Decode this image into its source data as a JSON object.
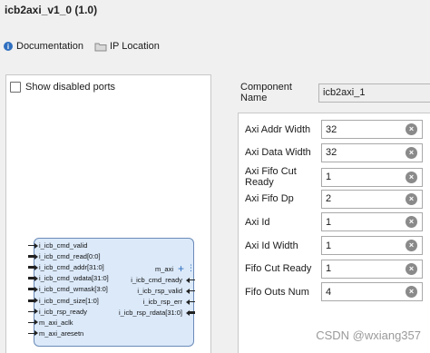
{
  "title": "icb2axi_v1_0 (1.0)",
  "toolbar": {
    "documentation_label": "Documentation",
    "documentation_icon": "book-icon",
    "ip_location_label": "IP Location",
    "ip_location_icon": "folder-icon"
  },
  "show_disabled_ports": {
    "label": "Show disabled ports",
    "checked": false
  },
  "symbol": {
    "left_ports": [
      "i_icb_cmd_valid",
      "i_icb_cmd_read[0:0]",
      "i_icb_cmd_addr[31:0]",
      "i_icb_cmd_wdata[31:0]",
      "i_icb_cmd_wmask[3:0]",
      "i_icb_cmd_size[1:0]",
      "i_icb_rsp_ready",
      "m_axi_aclk",
      "m_axi_aresetn"
    ],
    "right_ports": [
      "m_axi",
      "i_icb_cmd_ready",
      "i_icb_rsp_valid",
      "i_icb_rsp_err",
      "i_icb_rsp_rdata[31:0]"
    ],
    "colors": {
      "fill": "#dbe9f9",
      "border": "#6a8bb8"
    }
  },
  "component_name": {
    "label": "Component Name",
    "value": "icb2axi_1"
  },
  "parameters": [
    {
      "label": "Axi Addr Width",
      "value": "32"
    },
    {
      "label": "Axi Data Width",
      "value": "32"
    },
    {
      "label": "Axi Fifo Cut Ready",
      "value": "1"
    },
    {
      "label": "Axi Fifo Dp",
      "value": "2"
    },
    {
      "label": "Axi Id",
      "value": "1"
    },
    {
      "label": "Axi Id Width",
      "value": "1"
    },
    {
      "label": "Fifo Cut Ready",
      "value": "1"
    },
    {
      "label": "Fifo Outs Num",
      "value": "4"
    }
  ],
  "clear_icon": "clear-icon",
  "watermark": "CSDN @wxiang357"
}
